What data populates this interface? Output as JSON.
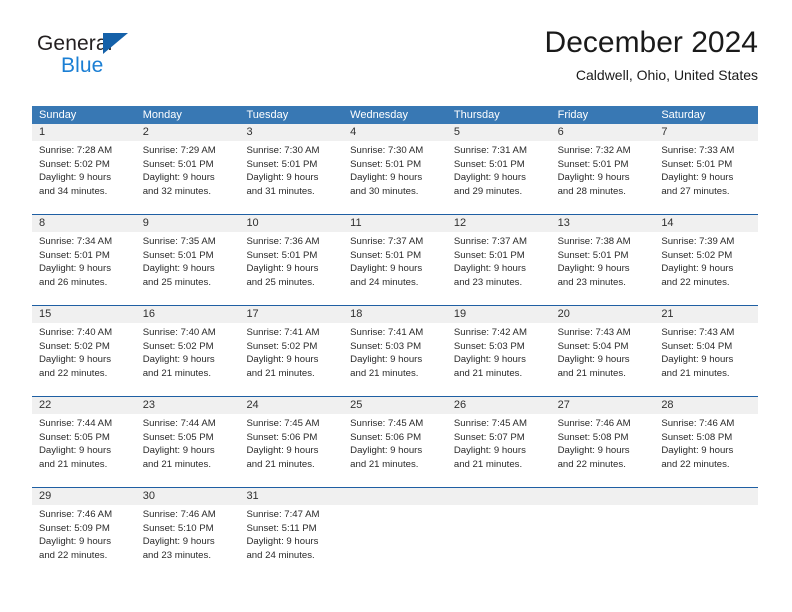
{
  "brand": {
    "word_one": "General",
    "word_two": "Blue",
    "flag_icon": "triangle-flag-icon",
    "primary_color": "#1561a9",
    "accent_color": "#1b7fd4"
  },
  "header": {
    "month_title": "December 2024",
    "location": "Caldwell, Ohio, United States"
  },
  "theme": {
    "header_blue": "#3878b4",
    "row_divider_blue": "#1f5fa3",
    "day_band_gray": "#f0f0f0"
  },
  "weekdays": [
    "Sunday",
    "Monday",
    "Tuesday",
    "Wednesday",
    "Thursday",
    "Friday",
    "Saturday"
  ],
  "weeks": [
    [
      {
        "day": "1",
        "sunrise": "Sunrise: 7:28 AM",
        "sunset": "Sunset: 5:02 PM",
        "daylight1": "Daylight: 9 hours",
        "daylight2": "and 34 minutes."
      },
      {
        "day": "2",
        "sunrise": "Sunrise: 7:29 AM",
        "sunset": "Sunset: 5:01 PM",
        "daylight1": "Daylight: 9 hours",
        "daylight2": "and 32 minutes."
      },
      {
        "day": "3",
        "sunrise": "Sunrise: 7:30 AM",
        "sunset": "Sunset: 5:01 PM",
        "daylight1": "Daylight: 9 hours",
        "daylight2": "and 31 minutes."
      },
      {
        "day": "4",
        "sunrise": "Sunrise: 7:30 AM",
        "sunset": "Sunset: 5:01 PM",
        "daylight1": "Daylight: 9 hours",
        "daylight2": "and 30 minutes."
      },
      {
        "day": "5",
        "sunrise": "Sunrise: 7:31 AM",
        "sunset": "Sunset: 5:01 PM",
        "daylight1": "Daylight: 9 hours",
        "daylight2": "and 29 minutes."
      },
      {
        "day": "6",
        "sunrise": "Sunrise: 7:32 AM",
        "sunset": "Sunset: 5:01 PM",
        "daylight1": "Daylight: 9 hours",
        "daylight2": "and 28 minutes."
      },
      {
        "day": "7",
        "sunrise": "Sunrise: 7:33 AM",
        "sunset": "Sunset: 5:01 PM",
        "daylight1": "Daylight: 9 hours",
        "daylight2": "and 27 minutes."
      }
    ],
    [
      {
        "day": "8",
        "sunrise": "Sunrise: 7:34 AM",
        "sunset": "Sunset: 5:01 PM",
        "daylight1": "Daylight: 9 hours",
        "daylight2": "and 26 minutes."
      },
      {
        "day": "9",
        "sunrise": "Sunrise: 7:35 AM",
        "sunset": "Sunset: 5:01 PM",
        "daylight1": "Daylight: 9 hours",
        "daylight2": "and 25 minutes."
      },
      {
        "day": "10",
        "sunrise": "Sunrise: 7:36 AM",
        "sunset": "Sunset: 5:01 PM",
        "daylight1": "Daylight: 9 hours",
        "daylight2": "and 25 minutes."
      },
      {
        "day": "11",
        "sunrise": "Sunrise: 7:37 AM",
        "sunset": "Sunset: 5:01 PM",
        "daylight1": "Daylight: 9 hours",
        "daylight2": "and 24 minutes."
      },
      {
        "day": "12",
        "sunrise": "Sunrise: 7:37 AM",
        "sunset": "Sunset: 5:01 PM",
        "daylight1": "Daylight: 9 hours",
        "daylight2": "and 23 minutes."
      },
      {
        "day": "13",
        "sunrise": "Sunrise: 7:38 AM",
        "sunset": "Sunset: 5:01 PM",
        "daylight1": "Daylight: 9 hours",
        "daylight2": "and 23 minutes."
      },
      {
        "day": "14",
        "sunrise": "Sunrise: 7:39 AM",
        "sunset": "Sunset: 5:02 PM",
        "daylight1": "Daylight: 9 hours",
        "daylight2": "and 22 minutes."
      }
    ],
    [
      {
        "day": "15",
        "sunrise": "Sunrise: 7:40 AM",
        "sunset": "Sunset: 5:02 PM",
        "daylight1": "Daylight: 9 hours",
        "daylight2": "and 22 minutes."
      },
      {
        "day": "16",
        "sunrise": "Sunrise: 7:40 AM",
        "sunset": "Sunset: 5:02 PM",
        "daylight1": "Daylight: 9 hours",
        "daylight2": "and 21 minutes."
      },
      {
        "day": "17",
        "sunrise": "Sunrise: 7:41 AM",
        "sunset": "Sunset: 5:02 PM",
        "daylight1": "Daylight: 9 hours",
        "daylight2": "and 21 minutes."
      },
      {
        "day": "18",
        "sunrise": "Sunrise: 7:41 AM",
        "sunset": "Sunset: 5:03 PM",
        "daylight1": "Daylight: 9 hours",
        "daylight2": "and 21 minutes."
      },
      {
        "day": "19",
        "sunrise": "Sunrise: 7:42 AM",
        "sunset": "Sunset: 5:03 PM",
        "daylight1": "Daylight: 9 hours",
        "daylight2": "and 21 minutes."
      },
      {
        "day": "20",
        "sunrise": "Sunrise: 7:43 AM",
        "sunset": "Sunset: 5:04 PM",
        "daylight1": "Daylight: 9 hours",
        "daylight2": "and 21 minutes."
      },
      {
        "day": "21",
        "sunrise": "Sunrise: 7:43 AM",
        "sunset": "Sunset: 5:04 PM",
        "daylight1": "Daylight: 9 hours",
        "daylight2": "and 21 minutes."
      }
    ],
    [
      {
        "day": "22",
        "sunrise": "Sunrise: 7:44 AM",
        "sunset": "Sunset: 5:05 PM",
        "daylight1": "Daylight: 9 hours",
        "daylight2": "and 21 minutes."
      },
      {
        "day": "23",
        "sunrise": "Sunrise: 7:44 AM",
        "sunset": "Sunset: 5:05 PM",
        "daylight1": "Daylight: 9 hours",
        "daylight2": "and 21 minutes."
      },
      {
        "day": "24",
        "sunrise": "Sunrise: 7:45 AM",
        "sunset": "Sunset: 5:06 PM",
        "daylight1": "Daylight: 9 hours",
        "daylight2": "and 21 minutes."
      },
      {
        "day": "25",
        "sunrise": "Sunrise: 7:45 AM",
        "sunset": "Sunset: 5:06 PM",
        "daylight1": "Daylight: 9 hours",
        "daylight2": "and 21 minutes."
      },
      {
        "day": "26",
        "sunrise": "Sunrise: 7:45 AM",
        "sunset": "Sunset: 5:07 PM",
        "daylight1": "Daylight: 9 hours",
        "daylight2": "and 21 minutes."
      },
      {
        "day": "27",
        "sunrise": "Sunrise: 7:46 AM",
        "sunset": "Sunset: 5:08 PM",
        "daylight1": "Daylight: 9 hours",
        "daylight2": "and 22 minutes."
      },
      {
        "day": "28",
        "sunrise": "Sunrise: 7:46 AM",
        "sunset": "Sunset: 5:08 PM",
        "daylight1": "Daylight: 9 hours",
        "daylight2": "and 22 minutes."
      }
    ],
    [
      {
        "day": "29",
        "sunrise": "Sunrise: 7:46 AM",
        "sunset": "Sunset: 5:09 PM",
        "daylight1": "Daylight: 9 hours",
        "daylight2": "and 22 minutes."
      },
      {
        "day": "30",
        "sunrise": "Sunrise: 7:46 AM",
        "sunset": "Sunset: 5:10 PM",
        "daylight1": "Daylight: 9 hours",
        "daylight2": "and 23 minutes."
      },
      {
        "day": "31",
        "sunrise": "Sunrise: 7:47 AM",
        "sunset": "Sunset: 5:11 PM",
        "daylight1": "Daylight: 9 hours",
        "daylight2": "and 24 minutes."
      },
      {
        "day": "",
        "sunrise": "",
        "sunset": "",
        "daylight1": "",
        "daylight2": ""
      },
      {
        "day": "",
        "sunrise": "",
        "sunset": "",
        "daylight1": "",
        "daylight2": ""
      },
      {
        "day": "",
        "sunrise": "",
        "sunset": "",
        "daylight1": "",
        "daylight2": ""
      },
      {
        "day": "",
        "sunrise": "",
        "sunset": "",
        "daylight1": "",
        "daylight2": ""
      }
    ]
  ]
}
